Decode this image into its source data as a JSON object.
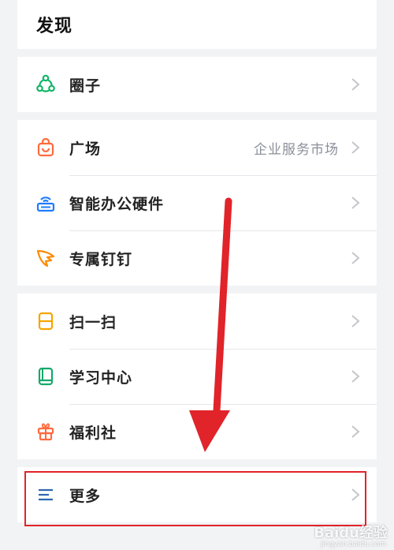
{
  "header": {
    "title": "发现"
  },
  "items": [
    {
      "id": "circle",
      "label": "圈子",
      "icon": "circle-nodes-icon",
      "color": "#11b566"
    },
    {
      "id": "plaza",
      "label": "广场",
      "meta": "企业服务市场",
      "icon": "shopping-bag-icon",
      "color": "#ff6a3d"
    },
    {
      "id": "hardware",
      "label": "智能办公硬件",
      "icon": "router-icon",
      "color": "#1f7bff"
    },
    {
      "id": "exclusive",
      "label": "专属钉钉",
      "icon": "wing-icon",
      "color": "#ff8a00"
    },
    {
      "id": "scan",
      "label": "扫一扫",
      "icon": "scan-icon",
      "color": "#f5a500"
    },
    {
      "id": "learning",
      "label": "学习中心",
      "icon": "book-icon",
      "color": "#16a86a"
    },
    {
      "id": "welfare",
      "label": "福利社",
      "icon": "gift-icon",
      "color": "#ff6a3d"
    },
    {
      "id": "more",
      "label": "更多",
      "icon": "menu-lines-icon",
      "color": "#2f67b1"
    }
  ],
  "annotation": {
    "highlight_color": "#e1232a"
  },
  "watermark": {
    "text": "Baidu经验",
    "subtext": "jingyan.baidu.com"
  }
}
